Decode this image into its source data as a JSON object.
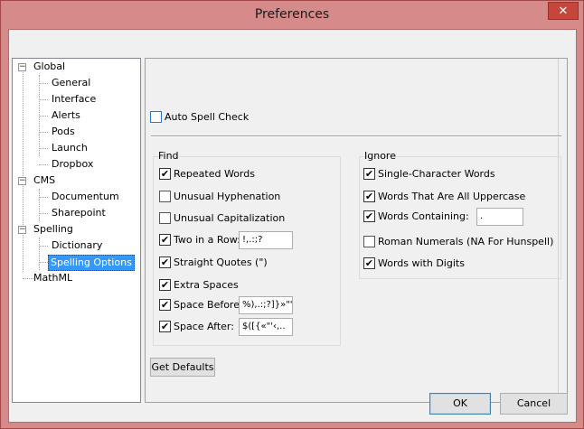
{
  "window": {
    "title": "Preferences",
    "close_glyph": "✕"
  },
  "tree": {
    "items": [
      {
        "label": "Global",
        "expander": "−"
      },
      {
        "label": "General"
      },
      {
        "label": "Interface"
      },
      {
        "label": "Alerts"
      },
      {
        "label": "Pods"
      },
      {
        "label": "Launch"
      },
      {
        "label": "Dropbox"
      },
      {
        "label": "CMS",
        "expander": "−"
      },
      {
        "label": "Documentum"
      },
      {
        "label": "Sharepoint"
      },
      {
        "label": "Spelling",
        "expander": "−"
      },
      {
        "label": "Dictionary"
      },
      {
        "label": "Spelling Options"
      },
      {
        "label": "MathML"
      }
    ],
    "selected": "Spelling Options"
  },
  "auto_spell_check": {
    "label": "Auto Spell Check",
    "checked": false
  },
  "find": {
    "title": "Find",
    "options": [
      {
        "label": "Repeated Words",
        "checked": true
      },
      {
        "label": "Unusual Hyphenation",
        "checked": false
      },
      {
        "label": "Unusual Capitalization",
        "checked": false
      },
      {
        "label": "Two in a Row:",
        "checked": true,
        "value": "!,.:;?"
      },
      {
        "label": "Straight Quotes (\")",
        "checked": true
      },
      {
        "label": "Extra Spaces",
        "checked": true
      },
      {
        "label": "Space Before:",
        "checked": true,
        "value": "%),.:;?]}»\"'›"
      },
      {
        "label": "Space After:",
        "checked": true,
        "value": "$([{«\"'‹,.."
      }
    ]
  },
  "ignore": {
    "title": "Ignore",
    "options": [
      {
        "label": "Single-Character Words",
        "checked": true
      },
      {
        "label": "Words That Are All Uppercase",
        "checked": true
      },
      {
        "label": "Words Containing:",
        "checked": true,
        "value": "."
      },
      {
        "label": "Roman Numerals (NA For Hunspell)",
        "checked": false
      },
      {
        "label": "Words with Digits",
        "checked": true
      }
    ]
  },
  "buttons": {
    "defaults": "Get Defaults",
    "ok": "OK",
    "cancel": "Cancel"
  },
  "colors": {
    "selection": "#3399ff",
    "frame": "#d68a8a",
    "close": "#c7463c"
  }
}
